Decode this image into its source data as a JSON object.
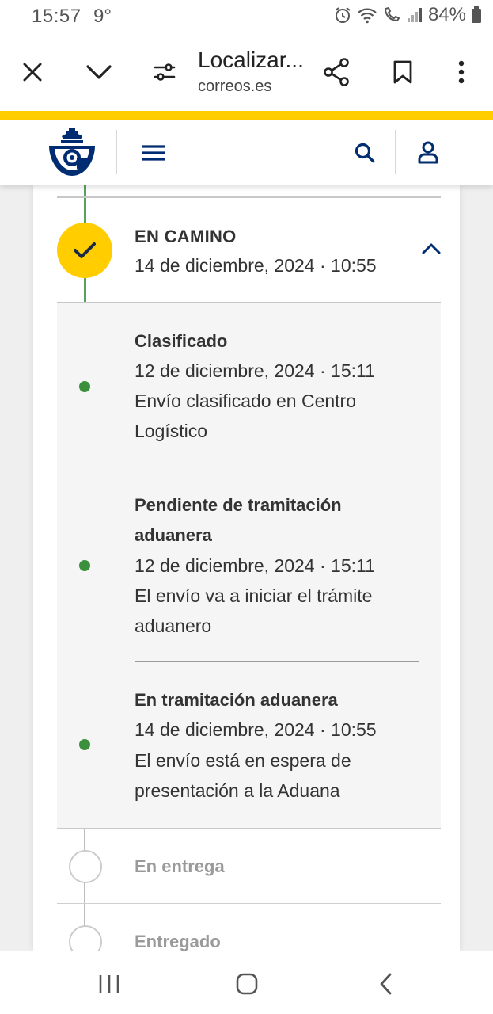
{
  "status_bar": {
    "time": "15:57",
    "temperature": "9°",
    "battery": "84%",
    "icons": [
      "alarm-icon",
      "wifi-icon",
      "wifi-call-icon",
      "signal-icon",
      "battery-icon"
    ]
  },
  "browser": {
    "title": "Localizar...",
    "domain": "correos.es",
    "buttons": [
      "close-icon",
      "chevron-down-icon",
      "page-settings-icon",
      "share-icon",
      "bookmark-icon",
      "more-icon"
    ]
  },
  "site": {
    "brand_color": "#ffcd00",
    "accent_color": "#002d72",
    "icons": [
      "correos-logo",
      "menu-icon",
      "search-icon",
      "user-icon"
    ]
  },
  "tracking": {
    "status": {
      "title": "EN CAMINO",
      "date": "14 de diciembre, 2024 · 10:55",
      "color": "#ffcd00"
    },
    "events": [
      {
        "title": "Clasificado",
        "date": "12 de diciembre, 2024 · 15:11",
        "description": "Envío clasificado en Centro Logístico"
      },
      {
        "title": "Pendiente de tramitación aduanera",
        "date": "12 de diciembre, 2024 · 15:11",
        "description": "El envío va a iniciar el trámite aduanero"
      },
      {
        "title": "En tramitación aduanera",
        "date": "14 de diciembre, 2024 · 10:55",
        "description": "El envío está en espera de presentación a la Aduana"
      }
    ],
    "pending": [
      "En entrega",
      "Entregado"
    ],
    "line_color_done": "#5aa15a",
    "line_color_pending": "#bdbdbd"
  },
  "system_nav": [
    "recents-icon",
    "home-icon",
    "back-icon"
  ]
}
